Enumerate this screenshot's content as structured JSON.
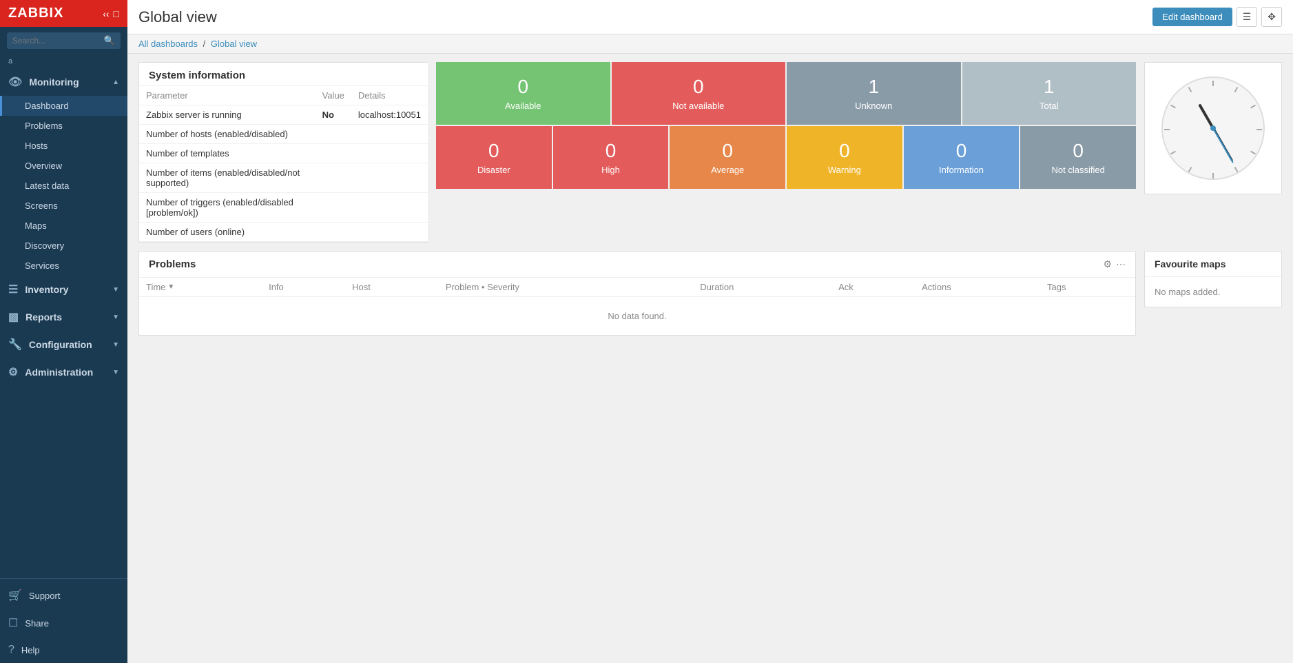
{
  "app": {
    "title": "Global view",
    "logo": "ZABBIX"
  },
  "breadcrumb": {
    "parent_label": "All dashboards",
    "current_label": "Global view",
    "separator": "/"
  },
  "topbar": {
    "edit_dashboard_label": "Edit dashboard"
  },
  "sidebar": {
    "user": "a",
    "search_placeholder": "Search...",
    "nav": [
      {
        "id": "monitoring",
        "label": "Monitoring",
        "icon": "eye",
        "expanded": true,
        "items": [
          {
            "id": "dashboard",
            "label": "Dashboard",
            "active": true
          },
          {
            "id": "problems",
            "label": "Problems"
          },
          {
            "id": "hosts",
            "label": "Hosts"
          },
          {
            "id": "overview",
            "label": "Overview"
          },
          {
            "id": "latest-data",
            "label": "Latest data"
          },
          {
            "id": "screens",
            "label": "Screens"
          },
          {
            "id": "maps",
            "label": "Maps"
          },
          {
            "id": "discovery",
            "label": "Discovery"
          },
          {
            "id": "services",
            "label": "Services"
          }
        ]
      },
      {
        "id": "inventory",
        "label": "Inventory",
        "icon": "list",
        "expanded": false,
        "items": []
      },
      {
        "id": "reports",
        "label": "Reports",
        "icon": "bar-chart",
        "expanded": false,
        "items": []
      },
      {
        "id": "configuration",
        "label": "Configuration",
        "icon": "wrench",
        "expanded": false,
        "items": []
      },
      {
        "id": "administration",
        "label": "Administration",
        "icon": "gear",
        "expanded": false,
        "items": []
      }
    ],
    "bottom": [
      {
        "id": "support",
        "label": "Support",
        "icon": "headset"
      },
      {
        "id": "share",
        "label": "Share",
        "icon": "share"
      },
      {
        "id": "help",
        "label": "Help",
        "icon": "question"
      }
    ]
  },
  "system_info": {
    "title": "System information",
    "columns": [
      "Parameter",
      "Value",
      "Details"
    ],
    "rows": [
      {
        "param": "Zabbix server is running",
        "value": "No",
        "details": "localhost:10051",
        "value_class": "val-no"
      },
      {
        "param": "Number of hosts (enabled/disabled)",
        "value": "",
        "details": ""
      },
      {
        "param": "Number of templates",
        "value": "",
        "details": ""
      },
      {
        "param": "Number of items (enabled/disabled/not supported)",
        "value": "",
        "details": ""
      },
      {
        "param": "Number of triggers (enabled/disabled [problem/ok])",
        "value": "",
        "details": ""
      },
      {
        "param": "Number of users (online)",
        "value": "",
        "details": ""
      }
    ]
  },
  "host_availability": {
    "top_row": [
      {
        "num": "0",
        "label": "Available",
        "class": "cell-green"
      },
      {
        "num": "0",
        "label": "Not available",
        "class": "cell-red"
      },
      {
        "num": "1",
        "label": "Unknown",
        "class": "cell-gray"
      },
      {
        "num": "1",
        "label": "Total",
        "class": "cell-lightgray"
      }
    ],
    "bottom_row": [
      {
        "num": "0",
        "label": "Disaster",
        "class": "cell-disaster"
      },
      {
        "num": "0",
        "label": "High",
        "class": "cell-high"
      },
      {
        "num": "0",
        "label": "Average",
        "class": "cell-average"
      },
      {
        "num": "0",
        "label": "Warning",
        "class": "cell-warning"
      },
      {
        "num": "0",
        "label": "Information",
        "class": "cell-info"
      },
      {
        "num": "0",
        "label": "Not classified",
        "class": "cell-nc"
      }
    ]
  },
  "problems": {
    "title": "Problems",
    "columns": [
      "Time",
      "Info",
      "Host",
      "Problem • Severity",
      "Duration",
      "Ack",
      "Actions",
      "Tags"
    ],
    "no_data": "No data found.",
    "gear_icon": "⚙",
    "dots_icon": "···"
  },
  "favourite_maps": {
    "title": "Favourite maps",
    "empty_message": "No maps added."
  },
  "clock": {
    "hour_rotation": "-30",
    "minute_rotation": "150",
    "second_rotation": "150"
  }
}
